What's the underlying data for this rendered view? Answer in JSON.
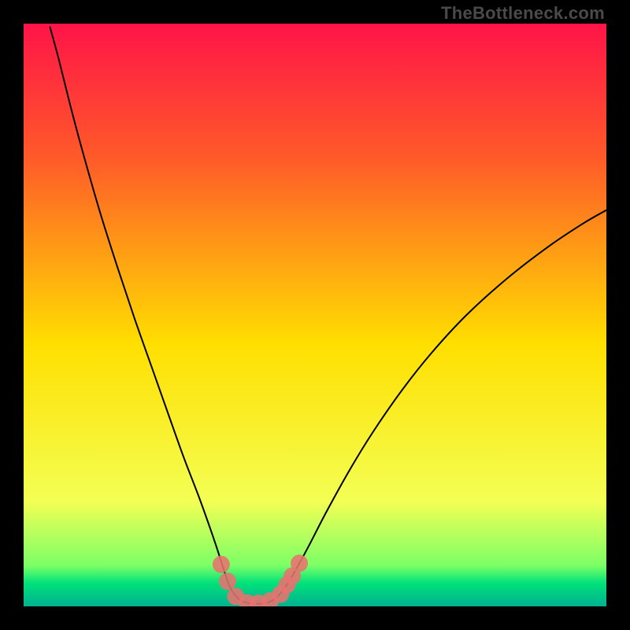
{
  "watermark": "TheBottleneck.com",
  "chart_data": {
    "type": "line",
    "title": "",
    "xlabel": "",
    "ylabel": "",
    "xlim": [
      0,
      100
    ],
    "ylim": [
      0,
      100
    ],
    "gradient_colors": {
      "top": "#ff1448",
      "upper": "#ff5a29",
      "mid": "#ffdf00",
      "lower": "#f3ff54",
      "green1": "#7cff66",
      "green2": "#00e27a",
      "green3": "#00c887",
      "green4": "#00b38f"
    },
    "series": [
      {
        "name": "bottleneck-curve",
        "stroke": "#000000",
        "stroke_width": 2.0,
        "points": [
          {
            "x": 4.5,
            "y": 99.5
          },
          {
            "x": 6.0,
            "y": 94.0
          },
          {
            "x": 8.0,
            "y": 86.0
          },
          {
            "x": 10.0,
            "y": 78.5
          },
          {
            "x": 13.0,
            "y": 68.0
          },
          {
            "x": 16.0,
            "y": 58.5
          },
          {
            "x": 19.0,
            "y": 49.5
          },
          {
            "x": 22.0,
            "y": 41.0
          },
          {
            "x": 25.0,
            "y": 32.5
          },
          {
            "x": 27.5,
            "y": 25.5
          },
          {
            "x": 30.0,
            "y": 19.0
          },
          {
            "x": 31.8,
            "y": 14.0
          },
          {
            "x": 33.0,
            "y": 10.5
          },
          {
            "x": 34.0,
            "y": 7.4
          },
          {
            "x": 34.7,
            "y": 5.2
          },
          {
            "x": 35.3,
            "y": 3.6
          },
          {
            "x": 36.0,
            "y": 2.3
          },
          {
            "x": 37.0,
            "y": 1.2
          },
          {
            "x": 38.5,
            "y": 0.55
          },
          {
            "x": 40.0,
            "y": 0.45
          },
          {
            "x": 41.5,
            "y": 0.55
          },
          {
            "x": 43.0,
            "y": 1.2
          },
          {
            "x": 44.3,
            "y": 2.5
          },
          {
            "x": 45.6,
            "y": 4.4
          },
          {
            "x": 47.0,
            "y": 6.8
          },
          {
            "x": 49.0,
            "y": 10.5
          },
          {
            "x": 52.0,
            "y": 16.3
          },
          {
            "x": 56.0,
            "y": 23.5
          },
          {
            "x": 60.0,
            "y": 30.0
          },
          {
            "x": 65.0,
            "y": 37.2
          },
          {
            "x": 70.0,
            "y": 43.5
          },
          {
            "x": 76.0,
            "y": 50.0
          },
          {
            "x": 83.0,
            "y": 56.3
          },
          {
            "x": 90.0,
            "y": 61.7
          },
          {
            "x": 96.0,
            "y": 65.7
          },
          {
            "x": 100.0,
            "y": 68.0
          }
        ]
      }
    ],
    "markers": {
      "fill": "#e8726f",
      "fill_opacity": 0.88,
      "radius": 11,
      "points": [
        {
          "x": 33.9,
          "y": 7.2
        },
        {
          "x": 35.0,
          "y": 4.3
        },
        {
          "x": 36.4,
          "y": 1.7
        },
        {
          "x": 38.4,
          "y": 0.6
        },
        {
          "x": 40.3,
          "y": 0.55
        },
        {
          "x": 42.3,
          "y": 0.95
        },
        {
          "x": 44.1,
          "y": 2.1
        },
        {
          "x": 45.2,
          "y": 3.7
        },
        {
          "x": 46.1,
          "y": 5.2
        },
        {
          "x": 47.3,
          "y": 7.4
        }
      ]
    }
  }
}
